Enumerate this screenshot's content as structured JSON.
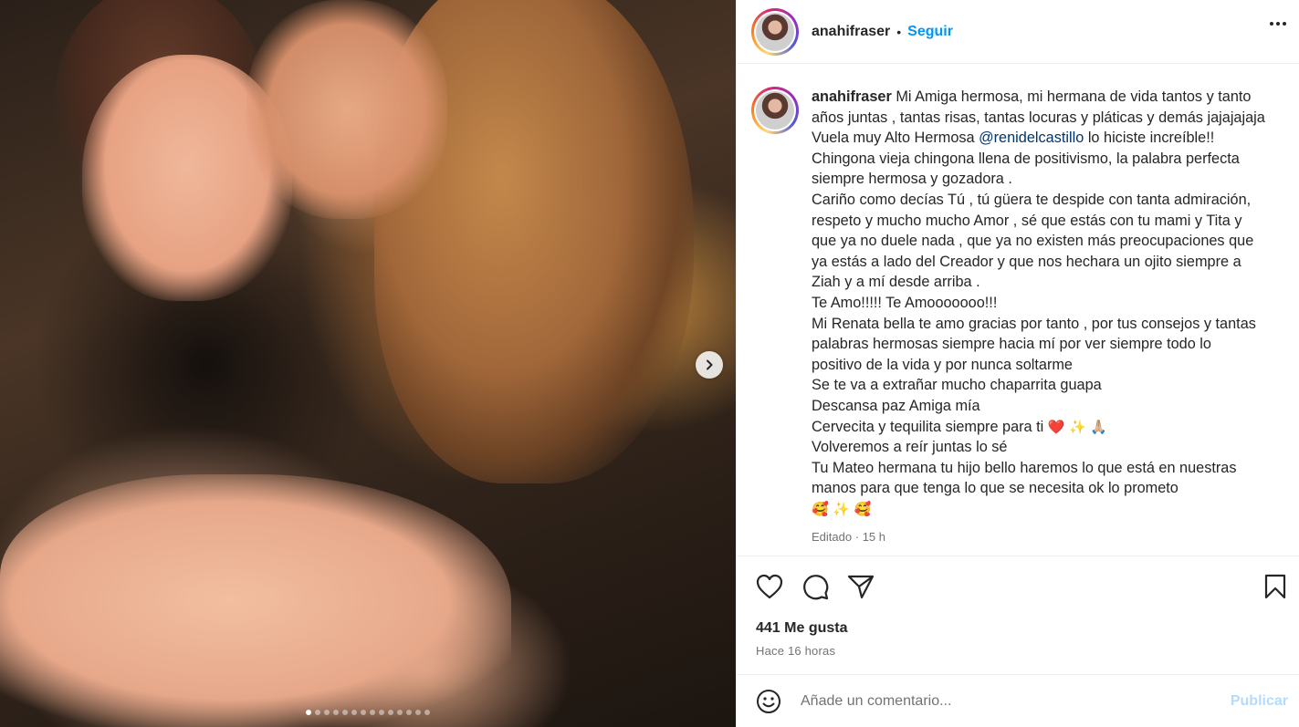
{
  "post": {
    "image_alt": "",
    "carousel": {
      "total": 14,
      "active_index": 0,
      "next_icon": "chevron-right-icon"
    }
  },
  "header": {
    "username": "anahifraser",
    "separator": "•",
    "follow_label": "Seguir",
    "more_icon": "more-horizontal-icon"
  },
  "caption": {
    "username": "anahifraser",
    "lines": [
      "Mi Amiga hermosa, mi hermana de vida tantos y tanto",
      "años juntas , tantas risas, tantas locuras y pláticas y demás jajajajaja",
      "Vuela muy Alto Hermosa",
      "Chingona vieja chingona llena de positivismo, la palabra perfecta",
      "siempre hermosa y gozadora .",
      "Cariño como decías Tú , tú güera te despide con tanta admiración,",
      "respeto y mucho mucho Amor , sé que estás con tu mami y Tita y",
      "que ya no duele nada , que ya no existen más preocupaciones que",
      "ya estás a lado del Creador y que nos hechara un ojito siempre a",
      "Ziah y a mí desde arriba .",
      "Te Amo!!!!! Te Amooooooo!!!",
      "Mi Renata bella te amo gracias por tanto , por tus consejos y tantas",
      "palabras hermosas siempre hacia mí por ver siempre todo lo",
      "positivo de la vida y por nunca soltarme",
      "Se te va a extrañar mucho chaparrita guapa",
      "Descansa paz Amiga mía",
      "Cervecita y tequilita siempre para ti",
      "Volveremos a reír juntas lo sé",
      "Tu Mateo hermana tu hijo bello haremos lo que está en nuestras",
      "manos para que tenga lo que se necesita ok lo prometo"
    ],
    "mention": "@renidelcastillo",
    "mention_suffix": "lo hiciste increíble!!",
    "emoji_line_16": [
      "❤️",
      "✨",
      "🙏🏼"
    ],
    "emoji_line_last": [
      "🥰",
      "✨",
      "🥰"
    ],
    "edited_label": "Editado",
    "meta_separator": "·",
    "edited_time": "15 h"
  },
  "actions": {
    "like_icon": "heart-icon",
    "comment_icon": "comment-icon",
    "share_icon": "send-icon",
    "save_icon": "bookmark-icon"
  },
  "likes_text": "441 Me gusta",
  "timestamp": "Hace 16 horas",
  "comment": {
    "emoji_icon": "smiley-icon",
    "placeholder": "Añade un comentario...",
    "value": "",
    "publish_label": "Publicar"
  },
  "colors": {
    "link_blue": "#0095f6",
    "mention_blue": "#00376b",
    "publish_disabled": "#b3dbff",
    "secondary_text": "#737373",
    "primary_text": "#262626"
  }
}
